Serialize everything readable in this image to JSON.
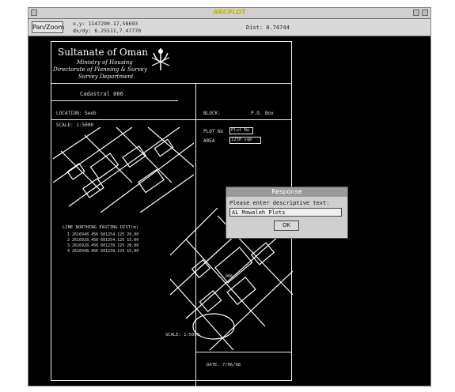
{
  "window": {
    "title": "ARCPLOT"
  },
  "toolbar": {
    "panzoom_label": "Pan/Zoom",
    "x_coord": "x,y:  1147290.17,58693",
    "y_coord": "dx/dy:  6.25511,7.47770",
    "distance": "Dist: 0.74744"
  },
  "sheet": {
    "org_name": "Sultanate of Oman",
    "ministry": "Ministry of Housing",
    "directorate": "Directorate of Planning & Survey",
    "dept": "Survey Department",
    "plot_label": "Cadastral 006",
    "location_label": "LOCATION: Seeb",
    "block_label": "BLOCK:",
    "block_value": "P.O. Box",
    "scale_label": "SCALE: 1:5000",
    "plot_no_label": "PLOT No",
    "plot_no_value": "Plot No",
    "area_label": "AREA",
    "area_value": "1250 sqm",
    "table_header": "LINE  NORTHING  EASTING  DIST(m)",
    "table_rows": [
      "1  2616948.456  601254.125  20.00",
      "2  2616928.456  601254.125  15.00",
      "3  2616928.456  601239.125  20.00",
      "4  2616948.456  601239.125  15.00"
    ],
    "inset_plot": "006",
    "scale_bar": "SCALE: 1:5000",
    "date_label": "DATE: 7/06/98"
  },
  "dialog": {
    "title": "Response",
    "prompt": "Please enter descriptive text:",
    "input_value": "AL Mawaleh Plots",
    "ok_label": "OK"
  }
}
